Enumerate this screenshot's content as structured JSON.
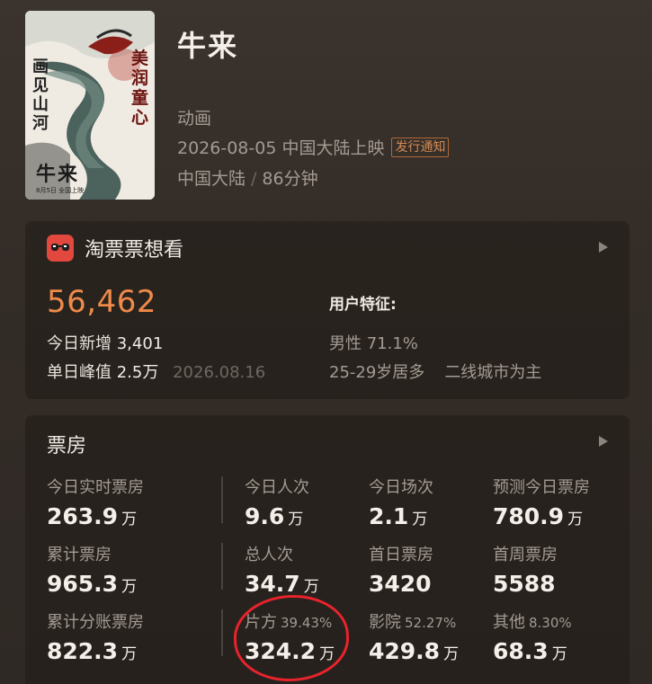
{
  "movie": {
    "title": "牛来",
    "genre": "动画",
    "release": "2026-08-05 中国大陆上映",
    "release_tag": "发行通知",
    "origin": "中国大陆",
    "origin_sep": "/",
    "duration": "86分钟"
  },
  "poster": {
    "text_right": "美润童心",
    "text_left": "画见山河",
    "text_bottom": "牛来",
    "date_line": "8月5日 全国上映"
  },
  "wish": {
    "title": "淘票票想看",
    "count": "56,462",
    "today_label": "今日新增",
    "today_value": "3,401",
    "peak_label": "单日峰值",
    "peak_value": "2.5万",
    "peak_date": "2026.08.16",
    "user_title": "用户特征:",
    "gender": "男性 71.1%",
    "age": "25-29岁居多",
    "city": "二线城市为主"
  },
  "box": {
    "title": "票房",
    "unit": "万",
    "cells": [
      {
        "label": "今日实时票房",
        "value": "263.9",
        "unit": "万"
      },
      {
        "label": "今日人次",
        "value": "9.6",
        "unit": "万"
      },
      {
        "label": "今日场次",
        "value": "2.1",
        "unit": "万"
      },
      {
        "label": "预测今日票房",
        "value": "780.9",
        "unit": "万"
      },
      {
        "label": "累计票房",
        "value": "965.3",
        "unit": "万"
      },
      {
        "label": "总人次",
        "value": "34.7",
        "unit": "万"
      },
      {
        "label": "首日票房",
        "value": "3420",
        "unit": ""
      },
      {
        "label": "首周票房",
        "value": "5588",
        "unit": ""
      },
      {
        "label": "累计分账票房",
        "value": "822.3",
        "unit": "万"
      },
      {
        "label": "片方",
        "pct": "39.43%",
        "value": "324.2",
        "unit": "万"
      },
      {
        "label": "影院",
        "pct": "52.27%",
        "value": "429.8",
        "unit": "万"
      },
      {
        "label": "其他",
        "pct": "8.30%",
        "value": "68.3",
        "unit": "万"
      }
    ]
  },
  "colors": {
    "accent": "#ef8a4a",
    "tag": "#d68a52",
    "annotation": "#e8232c",
    "logo": "#e2483d"
  }
}
